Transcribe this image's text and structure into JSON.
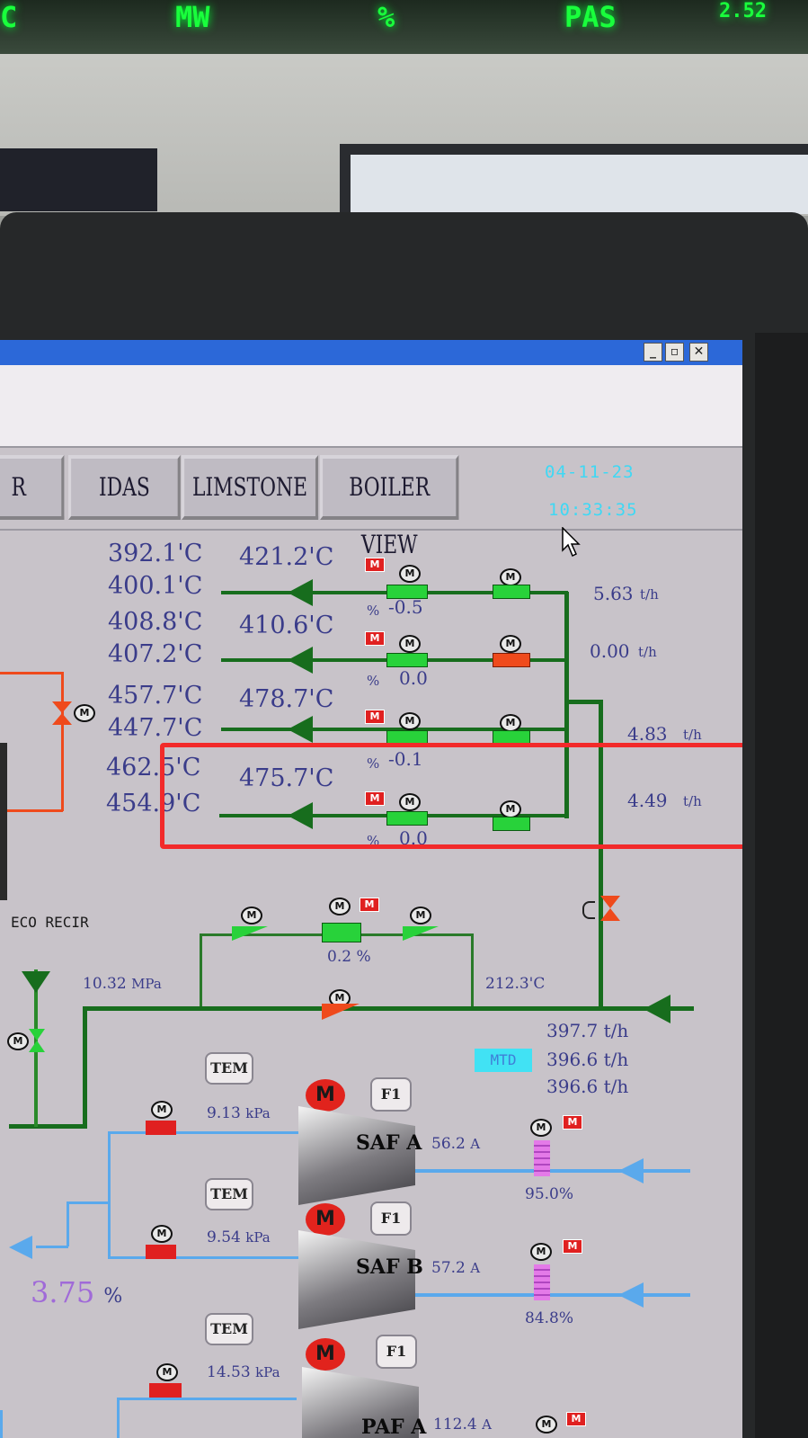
{
  "top_display": {
    "segments": [
      "C",
      "MW",
      "%",
      "PAS",
      "2.52"
    ]
  },
  "window": {
    "minimize_glyph": "_",
    "restore_glyph": "▫",
    "close_glyph": "✕"
  },
  "tabs": [
    {
      "label": "R"
    },
    {
      "label": "IDAS"
    },
    {
      "label": "LIMSTONE"
    },
    {
      "label": "BOILER VIEW"
    }
  ],
  "clock": {
    "date": "04-11-23",
    "time": "10:33:35"
  },
  "superheater_rows": [
    {
      "temp_in_top": "392.1'C",
      "temp_in_bottom": "400.1'C",
      "temp_mid": "421.2'C",
      "valve_pct_label": "%",
      "valve_value": "-0.5",
      "flow": "5.63",
      "flow_unit": "t/h"
    },
    {
      "temp_in_top": "408.8'C",
      "temp_in_bottom": "407.2'C",
      "temp_mid": "410.6'C",
      "valve_pct_label": "%",
      "valve_value": "0.0",
      "flow": "0.00",
      "flow_unit": "t/h"
    },
    {
      "temp_in_top": "457.7'C",
      "temp_in_bottom": "447.7'C",
      "temp_mid": "478.7'C",
      "valve_pct_label": "%",
      "valve_value": "-0.1",
      "flow": "4.83",
      "flow_unit": "t/h"
    },
    {
      "temp_in_top": "462.5'C",
      "temp_in_bottom": "454.9'C",
      "temp_mid": "475.7'C",
      "valve_pct_label": "%",
      "valve_value": "0.0",
      "flow": "4.49",
      "flow_unit": "t/h"
    }
  ],
  "feedwater": {
    "eco_recir_label": "ECO RECIR",
    "pressure": "10.32",
    "pressure_unit": "MPa",
    "bypass_valve_pct": "0.2 %",
    "temp": "212.3'C",
    "flow_1": "397.7 t/h",
    "mtd_label": "MTD",
    "flow_2": "396.6 t/h",
    "flow_3": "396.6 t/h"
  },
  "air_fans": [
    {
      "tem_label": "TEM",
      "pressure": "9.13",
      "pressure_unit": "kPa",
      "motor_label": "M",
      "f1_label": "F1",
      "name": "SAF A",
      "current": "56.2",
      "current_unit": "A",
      "damper_pct": "95.0%"
    },
    {
      "tem_label": "TEM",
      "pressure": "9.54",
      "pressure_unit": "kPa",
      "motor_label": "M",
      "f1_label": "F1",
      "name": "SAF B",
      "current": "57.2",
      "current_unit": "A",
      "damper_pct": "84.8%"
    },
    {
      "tem_label": "TEM",
      "pressure": "14.53",
      "pressure_unit": "kPa",
      "motor_label": "M",
      "f1_label": "F1",
      "name": "PAF A",
      "current": "112.4",
      "current_unit": "A",
      "damper_pct": ""
    }
  ],
  "o2": {
    "value": "3.75",
    "unit": "%"
  },
  "symbols": {
    "motor_letter": "M",
    "remote_mark": "M"
  },
  "colors": {
    "water_pipe": "#176d1d",
    "air_pipe": "#5aa9ec",
    "hot_line": "#ef4a1c",
    "value_text": "#3a3c8a",
    "clock_text": "#3fd8f4",
    "highlight_box": "#f22a2a",
    "led_green": "#19ff3c"
  }
}
